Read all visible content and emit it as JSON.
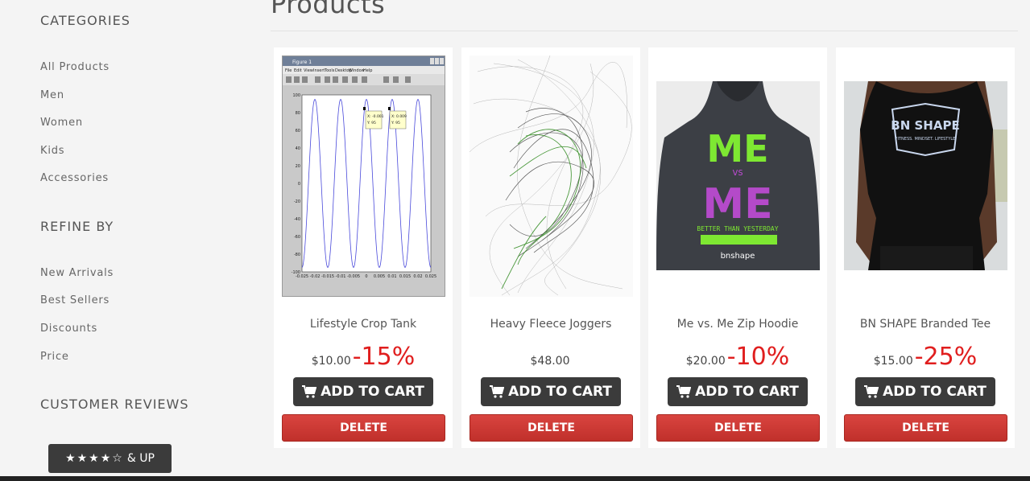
{
  "sidebar": {
    "categories_heading": "CATEGORIES",
    "categories": [
      "All Products",
      "Men",
      "Women",
      "Kids",
      "Accessories"
    ],
    "refine_heading": "REFINE BY",
    "refine": [
      "New Arrivals",
      "Best Sellers",
      "Discounts",
      "Price"
    ],
    "reviews_heading": "CUSTOMER REVIEWS",
    "rating_stars": "★★★★☆",
    "rating_suffix": "& UP"
  },
  "main": {
    "title": "Products",
    "products": [
      {
        "name": "Lifestyle Crop Tank",
        "price": "$10.00",
        "discount": "-15%",
        "add_label": "ADD TO CART",
        "delete_label": "DELETE"
      },
      {
        "name": "Heavy Fleece Joggers",
        "price": "$48.00",
        "discount": "",
        "add_label": "ADD TO CART",
        "delete_label": "DELETE"
      },
      {
        "name": "Me vs. Me Zip Hoodie",
        "price": "$20.00",
        "discount": "-10%",
        "add_label": "ADD TO CART",
        "delete_label": "DELETE"
      },
      {
        "name": "BN SHAPE Branded Tee",
        "price": "$15.00",
        "discount": "-25%",
        "add_label": "ADD TO CART",
        "delete_label": "DELETE"
      }
    ]
  },
  "images": {
    "hoodie_text_top": "ME",
    "hoodie_text_vs": "vs",
    "hoodie_text_bottom": "ME",
    "hoodie_banner": "BETTER THAN YESTERDAY",
    "hoodie_brand": "bnshape",
    "tee_logo_top": "BN SHAPE",
    "tee_logo_bottom": "FITNESS. MINDSET. LIFESTYLE",
    "figure_title": "Figure 1",
    "figure_menu": [
      "File",
      "Edit",
      "View",
      "Insert",
      "Tools",
      "Desktop",
      "Window",
      "Help"
    ],
    "figure_yticks": [
      "100",
      "80",
      "60",
      "40",
      "20",
      "0",
      "-20",
      "-40",
      "-60",
      "-80",
      "-100"
    ],
    "figure_xticks": [
      "-0.025",
      "-0.02",
      "-0.015",
      "-0.01",
      "-0.005",
      "0",
      "0.005",
      "0.01",
      "0.015",
      "0.02",
      "0.025"
    ],
    "figure_tip1": [
      "X: -0.001",
      "Y: 95"
    ],
    "figure_tip2": [
      "X: 0.009",
      "Y: 95"
    ]
  },
  "colors": {
    "button_dark": "#3b3b3b",
    "delete_red": "#c9372f",
    "discount_red": "#e01e1e",
    "hoodie_green": "#7ee832",
    "hoodie_purple": "#b44ac9"
  }
}
